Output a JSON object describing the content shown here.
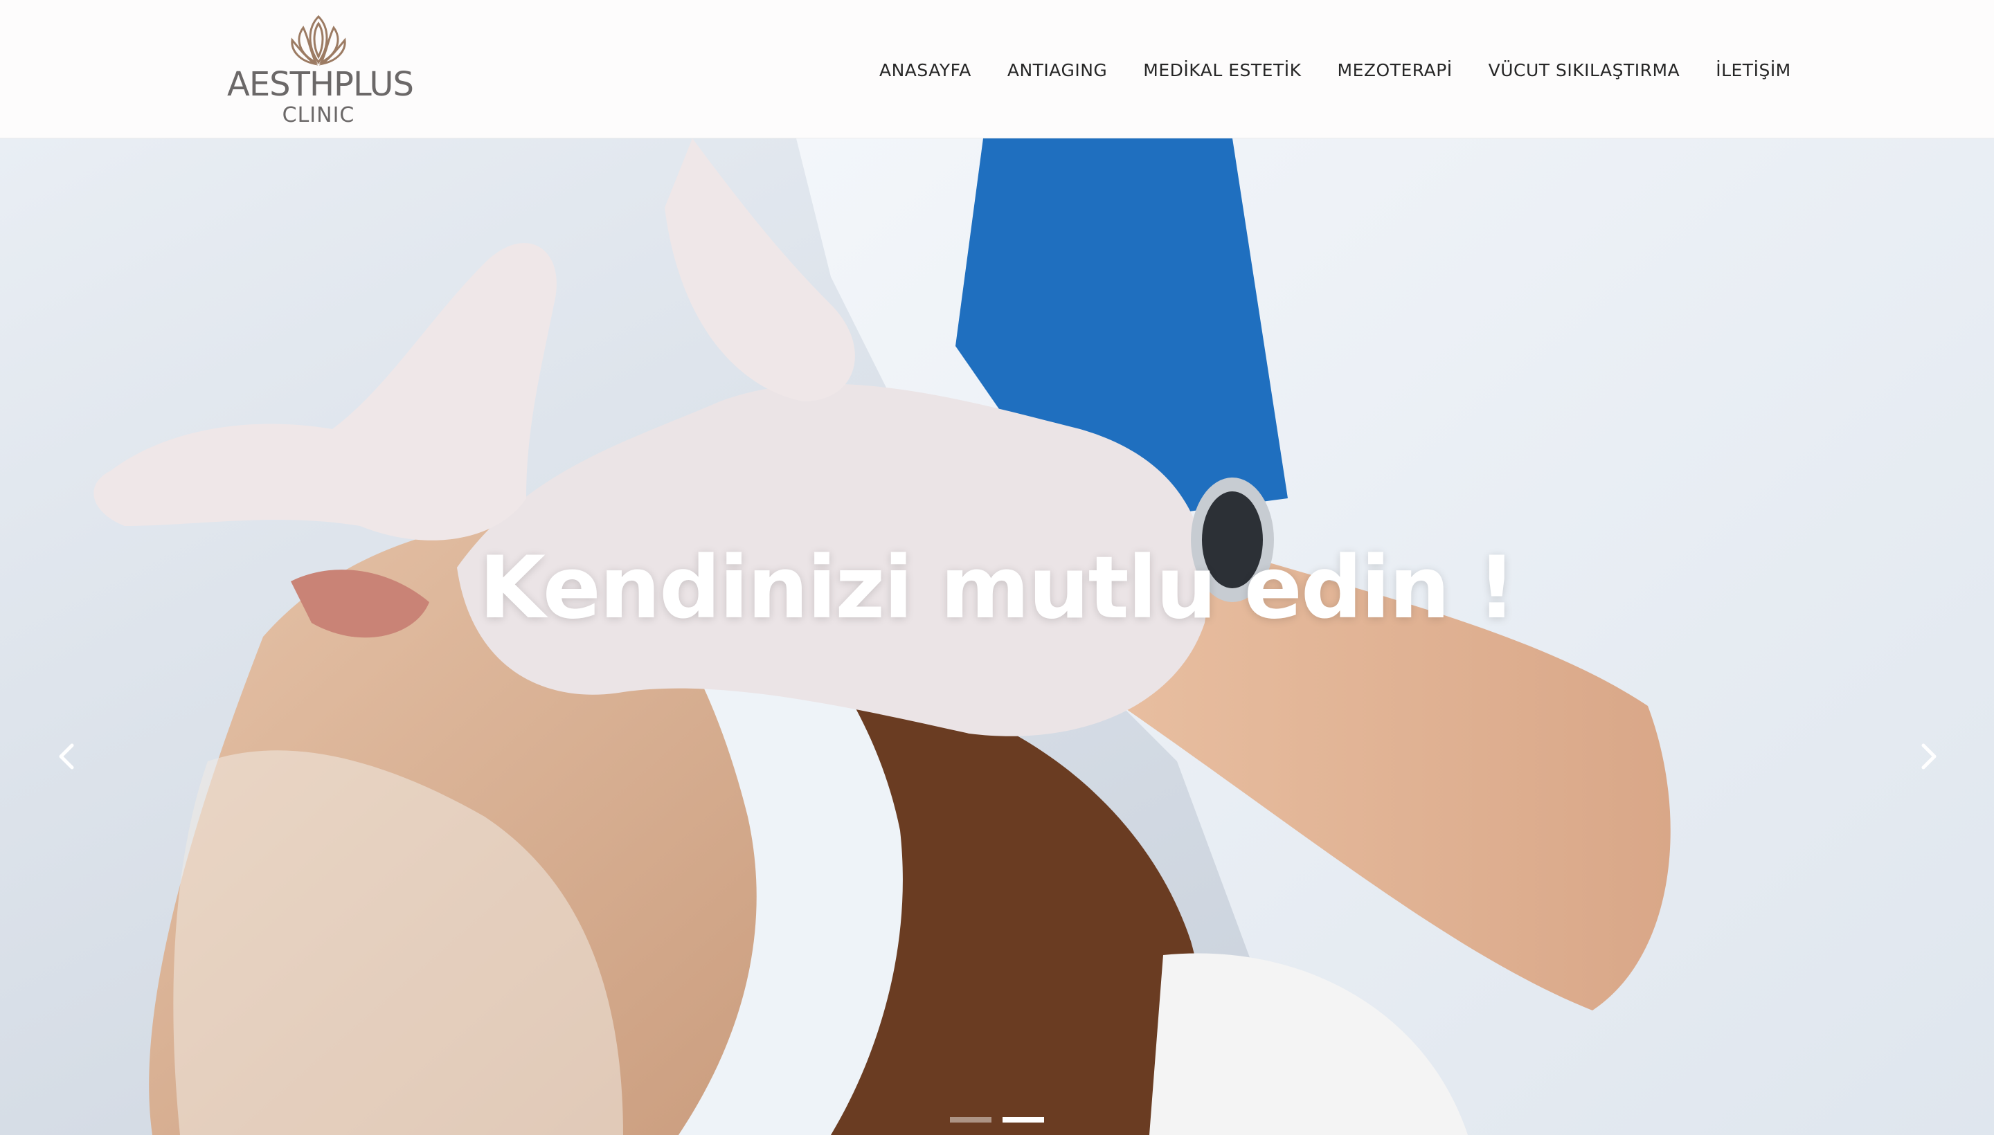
{
  "brand": {
    "name": "AESTHPLUS",
    "subtitle": "CLINIC",
    "logo_icon": "lotus-leaf-icon",
    "logo_color": "#6b6868",
    "logo_accent": "#9c7b63"
  },
  "nav": {
    "items": [
      {
        "label": "ANASAYFA"
      },
      {
        "label": "ANTIAGING"
      },
      {
        "label": "MEDİKAL ESTETİK"
      },
      {
        "label": "MEZOTERAPİ"
      },
      {
        "label": "VÜCUT SIKILAŞTIRMA"
      },
      {
        "label": "İLETİŞİM"
      }
    ]
  },
  "hero": {
    "title": "Kendinizi mutlu edin !",
    "prev_icon": "chevron-left-icon",
    "next_icon": "chevron-right-icon",
    "slide_count": 2,
    "active_slide": 2
  }
}
